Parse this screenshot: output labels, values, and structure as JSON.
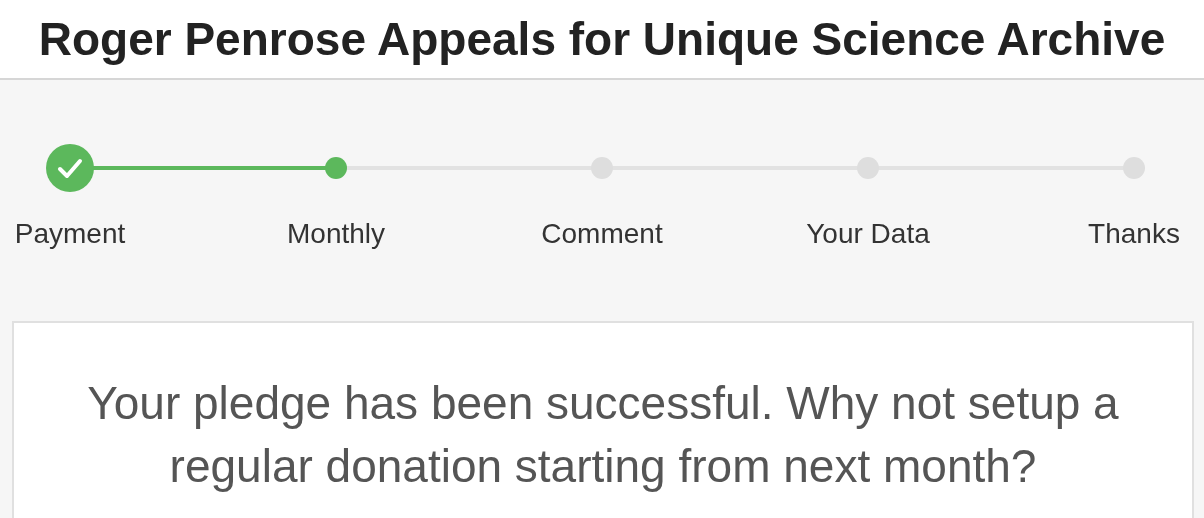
{
  "title": "Roger Penrose Appeals for Unique Science Archive",
  "steps": [
    {
      "label": "Payment",
      "completed": true,
      "selected": false
    },
    {
      "label": "Monthly",
      "completed": false,
      "selected": true
    },
    {
      "label": "Comment",
      "completed": false,
      "selected": false
    },
    {
      "label": "Your Data",
      "completed": false,
      "selected": false
    },
    {
      "label": "Thanks",
      "completed": false,
      "selected": false
    }
  ],
  "message": "Your pledge has been successful. Why not setup a regular donation starting from next month?"
}
